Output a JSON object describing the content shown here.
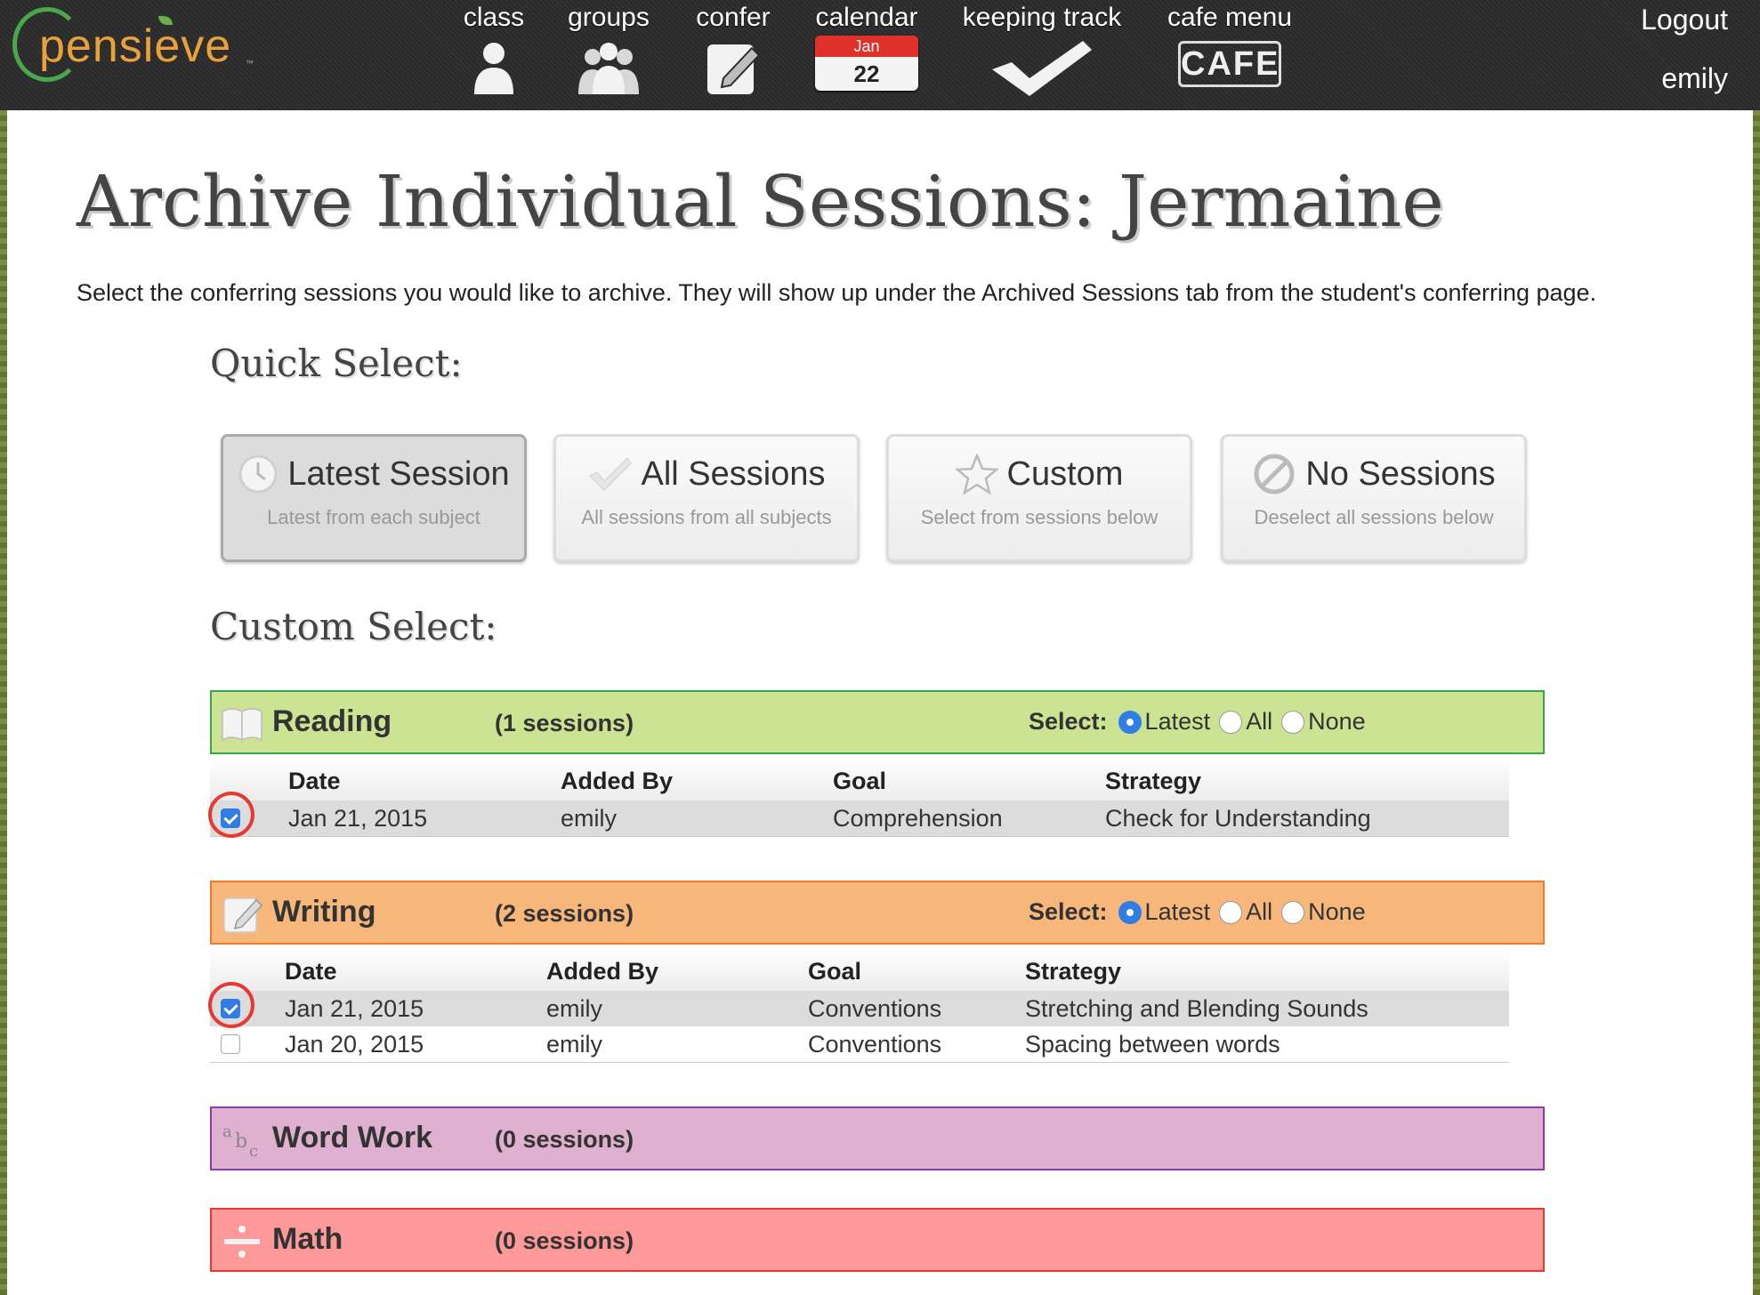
{
  "brand": {
    "name": "pensieve"
  },
  "nav": {
    "items": [
      {
        "label": "class",
        "icon": "person-icon"
      },
      {
        "label": "groups",
        "icon": "group-icon"
      },
      {
        "label": "confer",
        "icon": "notepad-pencil-icon"
      },
      {
        "label": "calendar",
        "icon": "calendar-icon",
        "month": "Jan",
        "day": "22"
      },
      {
        "label": "keeping track",
        "icon": "checkmark-icon"
      },
      {
        "label": "cafe menu",
        "icon": "cafe-sign-icon",
        "badge": "CAFE"
      }
    ],
    "logout": "Logout",
    "user": "emily"
  },
  "page": {
    "title": "Archive Individual Sessions: Jermaine",
    "intro": "Select the conferring sessions you would like to archive. They will show up under the Archived Sessions tab from the student's conferring page.",
    "quick_select_title": "Quick Select:",
    "custom_select_title": "Custom Select:"
  },
  "quick_select": [
    {
      "label": "Latest Session",
      "sub": "Latest from each subject",
      "icon": "clock-icon",
      "active": true
    },
    {
      "label": "All Sessions",
      "sub": "All sessions from all subjects",
      "icon": "check-icon",
      "active": false
    },
    {
      "label": "Custom",
      "sub": "Select from sessions below",
      "icon": "star-icon",
      "active": false
    },
    {
      "label": "No Sessions",
      "sub": "Deselect all sessions below",
      "icon": "no-entry-icon",
      "active": false
    }
  ],
  "select_labels": {
    "label": "Select:",
    "latest": "Latest",
    "all": "All",
    "none": "None"
  },
  "table_headers": {
    "date": "Date",
    "added_by": "Added By",
    "goal": "Goal",
    "strategy": "Strategy"
  },
  "subjects": [
    {
      "name": "Reading",
      "count": "(1 sessions)",
      "color": "#cce394",
      "border": "#3aa84a",
      "selected": "latest",
      "rows": [
        {
          "date": "Jan 21, 2015",
          "added_by": "emily",
          "goal": "Comprehension",
          "strategy": "Check for Understanding",
          "checked": true
        }
      ]
    },
    {
      "name": "Writing",
      "count": "(2 sessions)",
      "color": "#f7b77b",
      "border": "#ef7a2e",
      "selected": "latest",
      "rows": [
        {
          "date": "Jan 21, 2015",
          "added_by": "emily",
          "goal": "Conventions",
          "strategy": "Stretching and Blending Sounds",
          "checked": true
        },
        {
          "date": "Jan 20, 2015",
          "added_by": "emily",
          "goal": "Conventions",
          "strategy": "Spacing between words",
          "checked": false
        }
      ]
    },
    {
      "name": "Word Work",
      "count": "(0 sessions)",
      "color": "#dfb0cf",
      "border": "#8e3a9e"
    },
    {
      "name": "Math",
      "count": "(0 sessions)",
      "color": "#fe9999",
      "border": "#e53935"
    }
  ],
  "colors": {
    "accent": "#2f7ee6",
    "highlight": "#e53935"
  }
}
